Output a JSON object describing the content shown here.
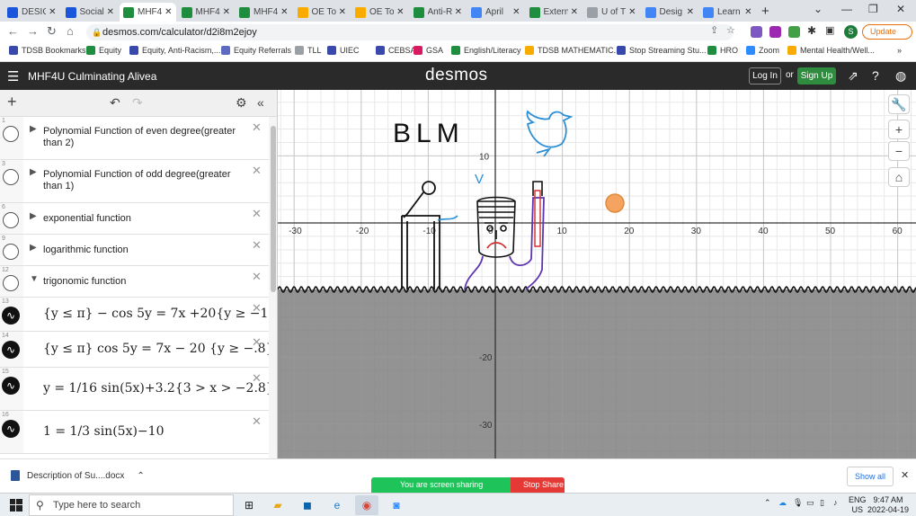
{
  "browser": {
    "tabs": [
      {
        "label": "DESIG",
        "color": "#1a56db"
      },
      {
        "label": "Social",
        "color": "#1a56db"
      },
      {
        "label": "MHF4",
        "color": "#1e8e3e"
      },
      {
        "label": "MHF4",
        "color": "#1e8e3e"
      },
      {
        "label": "MHF4",
        "color": "#1e8e3e"
      },
      {
        "label": "OE To",
        "color": "#f9ab00"
      },
      {
        "label": "OE To",
        "color": "#f9ab00"
      },
      {
        "label": "Anti-R",
        "color": "#1e8e3e"
      },
      {
        "label": "April",
        "color": "#4285f4"
      },
      {
        "label": "Extern",
        "color": "#1e8e3e"
      },
      {
        "label": "U of T",
        "color": "#9aa0a6"
      },
      {
        "label": "Desig",
        "color": "#4285f4"
      },
      {
        "label": "Learn",
        "color": "#4285f4"
      }
    ],
    "active_tab_index": 2,
    "url": "desmos.com/calculator/d2i8m2ejoy",
    "update_label": "Update",
    "profile_initial": "S",
    "bookmarks": [
      {
        "label": "TDSB Bookmarks",
        "color": "#3949ab"
      },
      {
        "label": "Equity",
        "color": "#1e8e3e"
      },
      {
        "label": "Equity, Anti-Racism,...",
        "color": "#3949ab"
      },
      {
        "label": "Equity Referrals",
        "color": "#5c6bc0"
      },
      {
        "label": "TLL",
        "color": "#9aa0a6"
      },
      {
        "label": "UIEC",
        "color": "#3949ab"
      },
      {
        "label": "CEBSA",
        "color": "#3949ab"
      },
      {
        "label": "GSA",
        "color": "#d81b60"
      },
      {
        "label": "English/Literacy",
        "color": "#1e8e3e"
      },
      {
        "label": "TDSB MATHEMATIC...",
        "color": "#f9ab00"
      },
      {
        "label": "Stop Streaming Stu...",
        "color": "#3949ab"
      },
      {
        "label": "HRO",
        "color": "#1e8e3e"
      },
      {
        "label": "Zoom",
        "color": "#2d8cff"
      },
      {
        "label": "Mental Health/Well...",
        "color": "#f9ab00"
      }
    ]
  },
  "desmos": {
    "graph_title": "MHF4U Culminating Alivea",
    "logo": "desmos",
    "login_label": "Log In",
    "or_label": "or",
    "signup_label": "Sign Up",
    "expressions": [
      {
        "num": "1",
        "kind": "folder",
        "collapsed": true,
        "text": "Polynomial Function of even degree(greater than 2)"
      },
      {
        "num": "3",
        "kind": "folder",
        "collapsed": true,
        "text": "Polynomial Function of odd degree(greater than 1)"
      },
      {
        "num": "6",
        "kind": "folder",
        "collapsed": true,
        "text": "exponential function"
      },
      {
        "num": "9",
        "kind": "folder",
        "collapsed": true,
        "text": "logarithmic function"
      },
      {
        "num": "12",
        "kind": "folder",
        "collapsed": false,
        "text": "trigonomic function"
      },
      {
        "num": "13",
        "kind": "math",
        "text": "{y ≤ π} − cos 5y = 7x +20{y ≥ −1}"
      },
      {
        "num": "14",
        "kind": "math",
        "text": "{y ≤ π} cos 5y = 7x − 20 {y ≥ −.8}"
      },
      {
        "num": "15",
        "kind": "math",
        "text": "y = 1/16 sin(5x)+3.2{3 > x > −2.8}"
      },
      {
        "num": "16",
        "kind": "math",
        "text": "1 = 1/3 sin(5x)−10"
      }
    ],
    "graph": {
      "x_ticks": [
        "-30",
        "-20",
        "-10",
        "0",
        "10",
        "20",
        "30",
        "40",
        "50",
        "60"
      ],
      "y_ticks": [
        "10",
        "-20",
        "-30"
      ],
      "drawing_text": "BLM",
      "v_label": "V",
      "point_color": "#f4a460",
      "shade_color": "#808080"
    }
  },
  "downloads": {
    "file": "Description of Su....docx",
    "show_all": "Show all"
  },
  "screenshare": {
    "status": "You are screen sharing",
    "stop": "Stop Share"
  },
  "taskbar": {
    "search_placeholder": "Type here to search",
    "lang_top": "ENG",
    "lang_bottom": "US",
    "time": "9:47 AM",
    "date": "2022-04-19"
  }
}
